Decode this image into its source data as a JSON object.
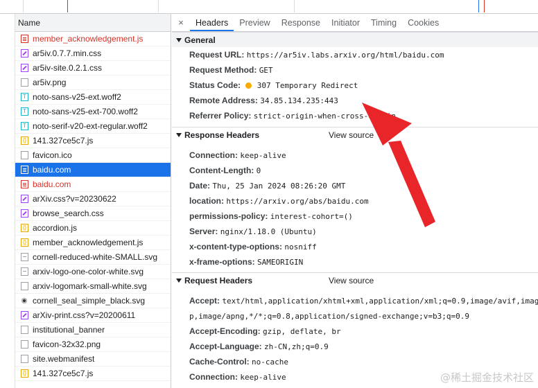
{
  "name_column": {
    "header": "Name"
  },
  "requests": [
    {
      "label": "member_acknowledgement.js",
      "type": "jserr",
      "error": true,
      "selected": false
    },
    {
      "label": "ar5iv.0.7.7.min.css",
      "type": "css",
      "error": false,
      "selected": false
    },
    {
      "label": "ar5iv-site.0.2.1.css",
      "type": "css",
      "error": false,
      "selected": false
    },
    {
      "label": "ar5iv.png",
      "type": "img",
      "error": false,
      "selected": false
    },
    {
      "label": "noto-sans-v25-ext.woff2",
      "type": "font",
      "error": false,
      "selected": false
    },
    {
      "label": "noto-sans-v25-ext-700.woff2",
      "type": "font",
      "error": false,
      "selected": false
    },
    {
      "label": "noto-serif-v20-ext-regular.woff2",
      "type": "font",
      "error": false,
      "selected": false
    },
    {
      "label": "141.327ce5c7.js",
      "type": "js",
      "error": false,
      "selected": false
    },
    {
      "label": "favicon.ico",
      "type": "img",
      "error": false,
      "selected": false
    },
    {
      "label": "baidu.com",
      "type": "docsel",
      "error": false,
      "selected": true
    },
    {
      "label": "baidu.com",
      "type": "docerr",
      "error": true,
      "selected": false
    },
    {
      "label": "arXiv.css?v=20230622",
      "type": "css",
      "error": false,
      "selected": false
    },
    {
      "label": "browse_search.css",
      "type": "css",
      "error": false,
      "selected": false
    },
    {
      "label": "accordion.js",
      "type": "js",
      "error": false,
      "selected": false
    },
    {
      "label": "member_acknowledgement.js",
      "type": "js",
      "error": false,
      "selected": false
    },
    {
      "label": "cornell-reduced-white-SMALL.svg",
      "type": "svg",
      "error": false,
      "selected": false
    },
    {
      "label": "arxiv-logo-one-color-white.svg",
      "type": "svg",
      "error": false,
      "selected": false
    },
    {
      "label": "arxiv-logomark-small-white.svg",
      "type": "img",
      "error": false,
      "selected": false
    },
    {
      "label": "cornell_seal_simple_black.svg",
      "type": "seal",
      "error": false,
      "selected": false
    },
    {
      "label": "arXiv-print.css?v=20200611",
      "type": "css",
      "error": false,
      "selected": false
    },
    {
      "label": "institutional_banner",
      "type": "img",
      "error": false,
      "selected": false
    },
    {
      "label": "favicon-32x32.png",
      "type": "img",
      "error": false,
      "selected": false
    },
    {
      "label": "site.webmanifest",
      "type": "img",
      "error": false,
      "selected": false
    },
    {
      "label": "141.327ce5c7.js",
      "type": "js",
      "error": false,
      "selected": false
    }
  ],
  "tabs": {
    "close": "×",
    "items": [
      "Headers",
      "Preview",
      "Response",
      "Initiator",
      "Timing",
      "Cookies"
    ]
  },
  "general": {
    "title": "General",
    "request_url_key": "Request URL:",
    "request_url": "https://ar5iv.labs.arxiv.org/html/baidu.com",
    "method_key": "Request Method:",
    "method": "GET",
    "status_key": "Status Code:",
    "status": "307 Temporary Redirect",
    "status_color": "#f9ab00",
    "remote_key": "Remote Address:",
    "remote": "34.85.134.235:443",
    "referrer_key": "Referrer Policy:",
    "referrer": "strict-origin-when-cross-origin"
  },
  "response_headers": {
    "title": "Response Headers",
    "view_source": "View source",
    "rows": [
      {
        "key": "Connection:",
        "value": "keep-alive"
      },
      {
        "key": "Content-Length:",
        "value": "0"
      },
      {
        "key": "Date:",
        "value": "Thu, 25 Jan 2024 08:26:20 GMT"
      },
      {
        "key": "location:",
        "value": "https://arxiv.org/abs/baidu.com"
      },
      {
        "key": "permissions-policy:",
        "value": "interest-cohort=()"
      },
      {
        "key": "Server:",
        "value": "nginx/1.18.0 (Ubuntu)"
      },
      {
        "key": "x-content-type-options:",
        "value": "nosniff"
      },
      {
        "key": "x-frame-options:",
        "value": "SAMEORIGIN"
      }
    ]
  },
  "request_headers": {
    "title": "Request Headers",
    "view_source": "View source",
    "accept_key": "Accept:",
    "accept_line1": "text/html,application/xhtml+xml,application/xml;q=0.9,image/avif,imag",
    "accept_line2": "p,image/apng,*/*;q=0.8,application/signed-exchange;v=b3;q=0.9",
    "rows": [
      {
        "key": "Accept-Encoding:",
        "value": "gzip, deflate, br"
      },
      {
        "key": "Accept-Language:",
        "value": "zh-CN,zh;q=0.9"
      },
      {
        "key": "Cache-Control:",
        "value": "no-cache"
      },
      {
        "key": "Connection:",
        "value": "keep-alive"
      }
    ]
  },
  "watermark": "@稀土掘金技术社区",
  "colors": {
    "accent": "#1a73e8",
    "error": "#d93025",
    "annotation_arrow": "#e8262a"
  }
}
